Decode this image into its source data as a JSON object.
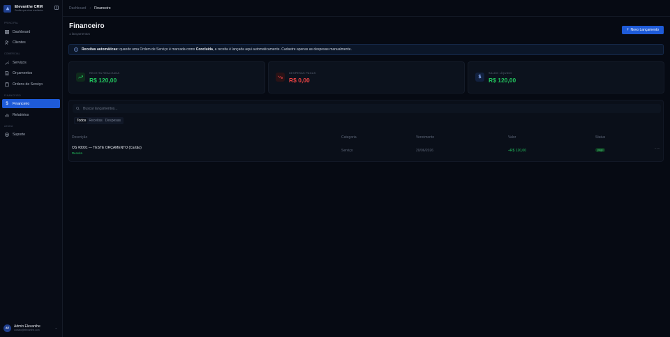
{
  "brand": {
    "title": "Elevanthe CRM",
    "subtitle": "Gestão que eleva resultados"
  },
  "sidebar": {
    "sections": {
      "principal": "PRINCIPAL",
      "comercial": "COMERCIAL",
      "financeiro": "FINANCEIRO",
      "ajuda": "AJUDA"
    },
    "items": [
      {
        "label": "Dashboard",
        "icon": "grid-icon"
      },
      {
        "label": "Clientes",
        "icon": "users-icon"
      },
      {
        "label": "Serviços",
        "icon": "wrench-icon"
      },
      {
        "label": "Orçamentos",
        "icon": "document-icon"
      },
      {
        "label": "Ordens de Serviço",
        "icon": "clipboard-icon"
      },
      {
        "label": "Financeiro",
        "icon": "dollar-icon",
        "active": true
      },
      {
        "label": "Relatórios",
        "icon": "bar-chart-icon"
      },
      {
        "label": "Suporte",
        "icon": "help-circle-icon"
      }
    ]
  },
  "user": {
    "initials": "AE",
    "name": "Admin Elevanthe",
    "email": "contato@elevanthe.com"
  },
  "breadcrumb": {
    "parent": "Dashboard",
    "current": "Financeiro"
  },
  "page": {
    "title": "Financeiro",
    "subtitle": "1 lançamentos",
    "new_button": "Novo Lançamento"
  },
  "banner": {
    "strong": "Receitas automáticas:",
    "text_a": " quando uma Ordem de Serviço é marcada como ",
    "strong2": "Concluída",
    "text_b": ", a receita é lançada aqui automaticamente. Cadastre apenas as despesas manualmente."
  },
  "cards": [
    {
      "label": "RECEITA REALIZADA",
      "value": "R$ 120,00",
      "color": "#22c55e",
      "icon": "trending-up-icon"
    },
    {
      "label": "DESPESAS PAGAS",
      "value": "R$ 0,00",
      "color": "#ef4444",
      "icon": "trending-down-icon"
    },
    {
      "label": "SALDO LÍQUIDO",
      "value": "R$ 120,00",
      "color": "#22c55e",
      "icon": "dollar-icon"
    }
  ],
  "search": {
    "placeholder": "Buscar lançamentos..."
  },
  "filters": [
    "Todos",
    "Receitas",
    "Despesas"
  ],
  "table": {
    "headers": [
      "Descrição",
      "Categoria",
      "Vencimento",
      "Valor",
      "Status"
    ],
    "rows": [
      {
        "description": "OS #0001 — TESTE ORÇAMENTO (Cartão)",
        "type": "Receita",
        "category": "Serviço",
        "due": "20/06/2026",
        "value": "+R$ 120,00",
        "status": "pago"
      }
    ]
  },
  "colors": {
    "accent": "#1e5bd8",
    "positive": "#22c55e",
    "negative": "#ef4444",
    "background": "#060a13"
  }
}
